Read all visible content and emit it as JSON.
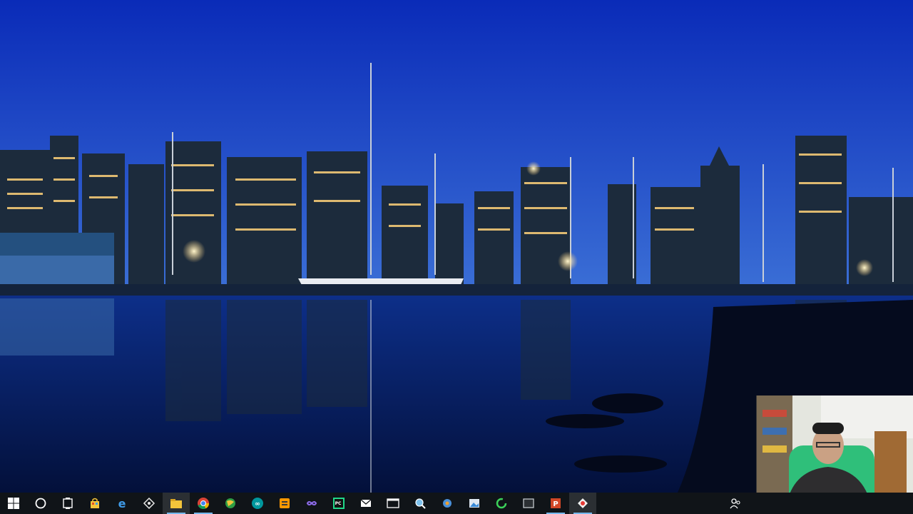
{
  "desktop": {
    "wallpaper": "city-skyline-night-harbor-reflection",
    "colors": {
      "sky_top": "#0a2bb8",
      "sky_bottom": "#3b6fd6",
      "water": "#061a55",
      "lights": "#ffd27a"
    }
  },
  "taskbar": {
    "background": "#101418",
    "accent": "#76b9ed",
    "items": [
      {
        "icon": "windows-start-icon",
        "running": false
      },
      {
        "icon": "search-circle-icon",
        "running": false
      },
      {
        "icon": "task-view-icon",
        "running": false
      },
      {
        "icon": "store-bag-icon",
        "running": false
      },
      {
        "icon": "edge-browser-icon",
        "running": false
      },
      {
        "icon": "snipping-tool-icon",
        "running": false
      },
      {
        "icon": "file-explorer-icon",
        "running": true
      },
      {
        "icon": "chrome-browser-icon",
        "running": true
      },
      {
        "icon": "globe-app-icon",
        "running": false
      },
      {
        "icon": "arduino-icon",
        "running": false
      },
      {
        "icon": "sublime-text-icon",
        "running": false
      },
      {
        "icon": "infinity-app-icon",
        "running": false
      },
      {
        "icon": "pycharm-icon",
        "running": false
      },
      {
        "icon": "mail-icon",
        "running": false
      },
      {
        "icon": "terminal-icon",
        "running": false
      },
      {
        "icon": "magnifier-app-icon",
        "running": false
      },
      {
        "icon": "gear-app-icon",
        "running": false
      },
      {
        "icon": "picture-app-icon",
        "running": false
      },
      {
        "icon": "green-ring-icon",
        "running": false
      },
      {
        "icon": "window-app-icon",
        "running": false
      },
      {
        "icon": "powerpoint-icon",
        "running": true
      },
      {
        "icon": "recorder-app-icon",
        "running": true,
        "active": true
      }
    ],
    "tray": [
      {
        "icon": "people-icon"
      }
    ]
  },
  "webcam_overlay": {
    "subject": "presenter-webcam-feed"
  }
}
